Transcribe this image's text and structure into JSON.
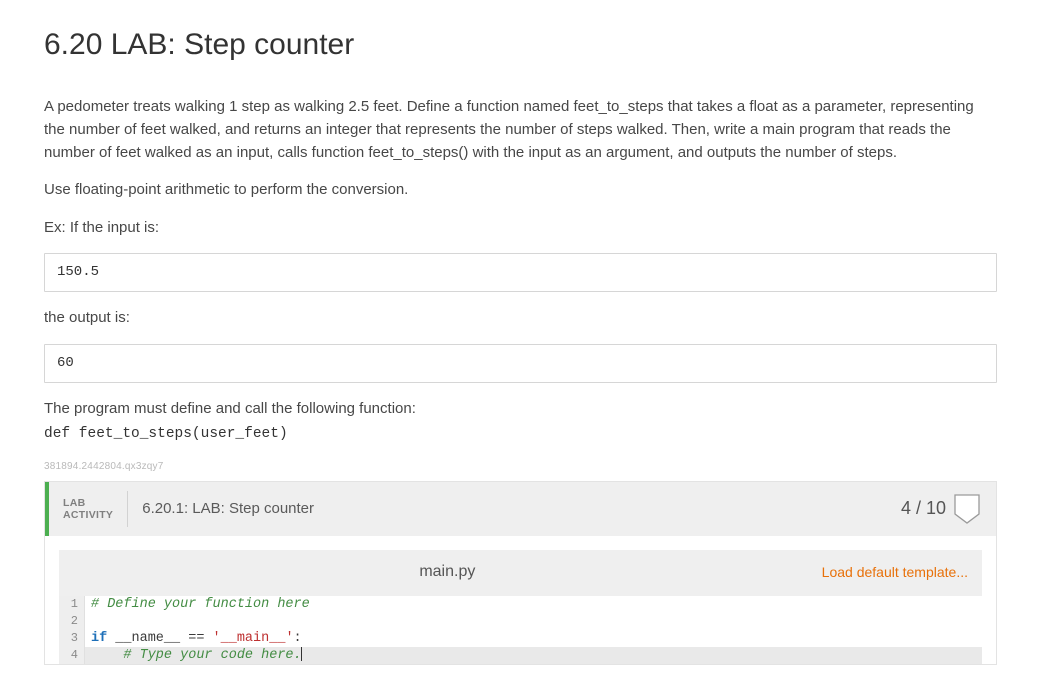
{
  "title": "6.20 LAB: Step counter",
  "paragraphs": {
    "intro": "A pedometer treats walking 1 step as walking 2.5 feet. Define a function named feet_to_steps that takes a float as a parameter, representing the number of feet walked, and returns an integer that represents the number of steps walked. Then, write a main program that reads the number of feet walked as an input, calls function feet_to_steps() with the input as an argument, and outputs the number of steps.",
    "useFloat": "Use floating-point arithmetic to perform the conversion.",
    "exIf": "Ex: If the input is:",
    "inputExample": "150.5",
    "outputIs": "the output is:",
    "outputExample": "60",
    "mustDefine": "The program must define and call the following function:",
    "funcDef": "def feet_to_steps(user_feet)",
    "tinyId": "381894.2442804.qx3zqy7"
  },
  "lab": {
    "badgeLine1": "LAB",
    "badgeLine2": "ACTIVITY",
    "title": "6.20.1: LAB: Step counter",
    "score": "4 / 10",
    "fileName": "main.py",
    "loadTemplate": "Load default template...",
    "code": {
      "l1_comment": "# Define your function here",
      "l3_kw": "if",
      "l3_mid": " __name__ == ",
      "l3_str": "'__main__'",
      "l3_end": ":",
      "l4_indent": "    ",
      "l4_comment": "# Type your code here."
    }
  }
}
